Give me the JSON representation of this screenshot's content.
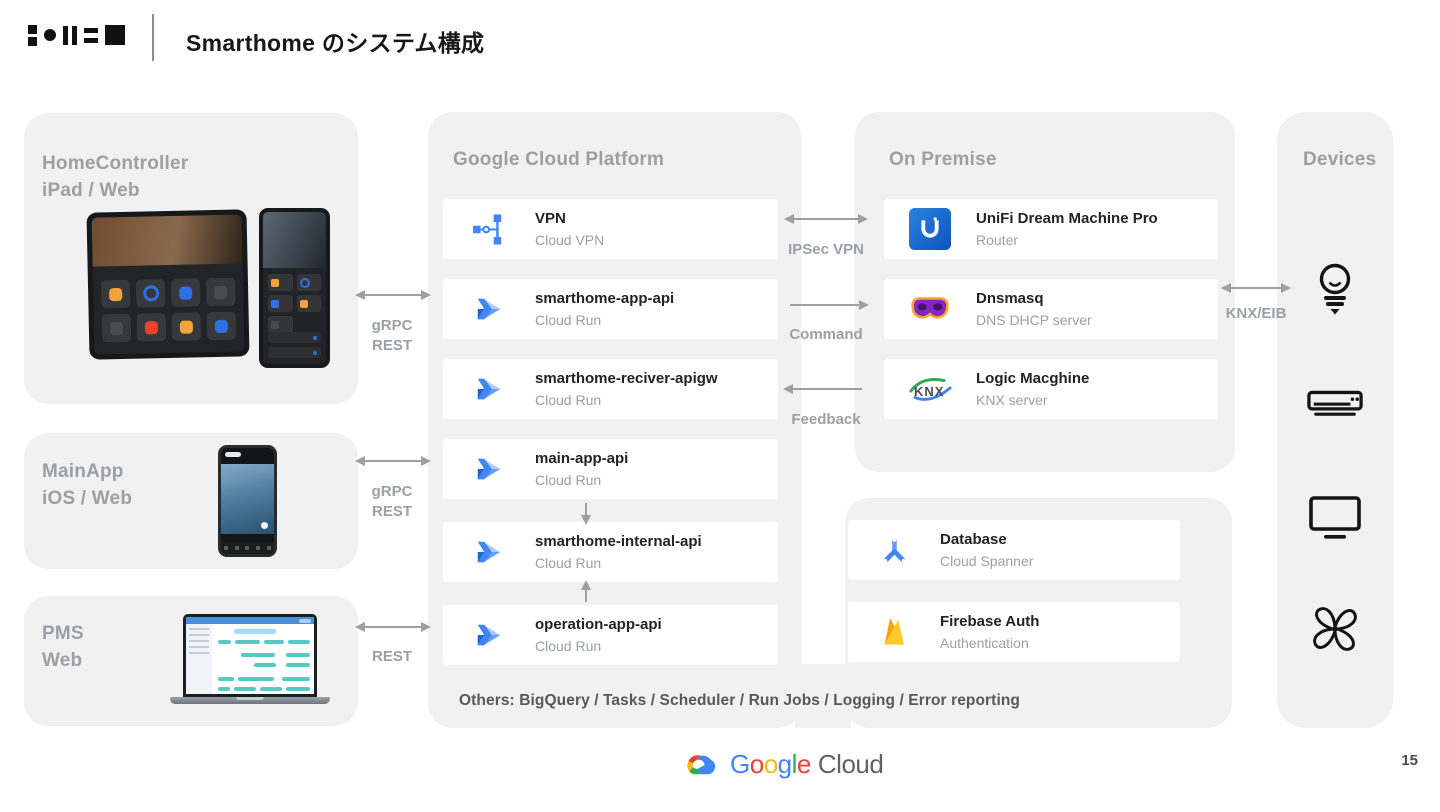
{
  "header": {
    "title": "Smarthome のシステム構成"
  },
  "clients": [
    {
      "name": "HomeController",
      "platform": "iPad / Web"
    },
    {
      "name": "MainApp",
      "platform": "iOS / Web"
    },
    {
      "name": "PMS",
      "platform": "Web"
    }
  ],
  "gcp": {
    "title": "Google Cloud Platform",
    "cards": [
      {
        "title": "VPN",
        "subtitle": "Cloud VPN",
        "icon": "cloud-vpn-icon"
      },
      {
        "title": "smarthome-app-api",
        "subtitle": "Cloud Run",
        "icon": "cloud-run-icon"
      },
      {
        "title": "smarthome-reciver-apigw",
        "subtitle": "Cloud Run",
        "icon": "cloud-run-icon"
      },
      {
        "title": "main-app-api",
        "subtitle": "Cloud Run",
        "icon": "cloud-run-icon"
      },
      {
        "title": "smarthome-internal-api",
        "subtitle": "Cloud Run",
        "icon": "cloud-run-icon"
      },
      {
        "title": "operation-app-api",
        "subtitle": "Cloud Run",
        "icon": "cloud-run-icon"
      }
    ],
    "others": "Others: BigQuery / Tasks / Scheduler / Run Jobs / Logging / Error reporting"
  },
  "onpremise": {
    "title": "On Premise",
    "cards": [
      {
        "title": "UniFi Dream Machine Pro",
        "subtitle": "Router",
        "icon": "unifi-router-icon"
      },
      {
        "title": "Dnsmasq",
        "subtitle": "DNS DHCP server",
        "icon": "dnsmasq-mask-icon"
      },
      {
        "title": "Logic Macghine",
        "subtitle": "KNX server",
        "icon": "knx-logo-icon",
        "icon_text": "KNX"
      }
    ]
  },
  "shared_services": {
    "cards": [
      {
        "title": "Database",
        "subtitle": "Cloud Spanner",
        "icon": "cloud-spanner-icon"
      },
      {
        "title": "Firebase Auth",
        "subtitle": "Authentication",
        "icon": "firebase-icon"
      }
    ]
  },
  "devices": {
    "title": "Devices",
    "items": [
      {
        "icon": "light-bulb-icon"
      },
      {
        "icon": "air-conditioner-icon"
      },
      {
        "icon": "tv-icon"
      },
      {
        "icon": "fan-icon"
      }
    ]
  },
  "connections": {
    "homecontroller_gcp": {
      "line1": "gRPC",
      "line2": "REST"
    },
    "mainapp_gcp": {
      "line1": "gRPC",
      "line2": "REST"
    },
    "pms_gcp": {
      "label": "REST"
    },
    "vpn_link": {
      "label": "IPSec VPN"
    },
    "command_link": {
      "label": "Command"
    },
    "feedback_link": {
      "label": "Feedback"
    },
    "devices_link": {
      "label": "KNX/EIB"
    }
  },
  "footer": {
    "brand_letters": [
      "G",
      "o",
      "o",
      "g",
      "l",
      "e"
    ],
    "brand_suffix": "Cloud",
    "page_number": "15"
  },
  "colors": {
    "panel_bg": "#f1f1f2",
    "card_bg": "#ffffff",
    "muted_text": "#9aa0a6",
    "title_text": "#17181a",
    "arrow": "#9aa0a6",
    "google_blue": "#4285f4",
    "google_red": "#ea4335",
    "google_yellow": "#fbbc05",
    "google_green": "#34a853"
  }
}
